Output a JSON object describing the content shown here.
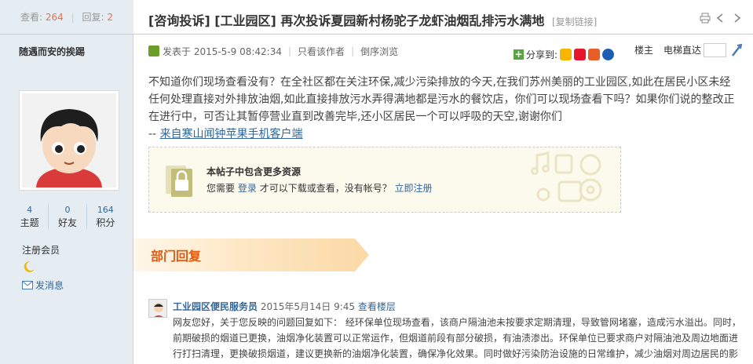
{
  "sidebar": {
    "views_label": "查看:",
    "views": "264",
    "replies_label": "回复:",
    "replies": "2",
    "username": "随遇而安的挨踢",
    "stats": [
      {
        "value": "4",
        "label": "主题"
      },
      {
        "value": "0",
        "label": "好友"
      },
      {
        "value": "164",
        "label": "积分"
      }
    ],
    "role": "注册会员",
    "message_label": "发消息"
  },
  "post": {
    "title": "[咨询投诉] [工业园区] 再次投诉夏园新村杨驼子龙虾油烟乱排污水满地",
    "copy_link": "[复制链接]",
    "posted_at": "发表于 2015-5-9 08:42:34",
    "only_author": "只看该作者",
    "reverse": "倒序浏览",
    "share_label": "分享到:",
    "floor_owner": "楼主",
    "floor_jump": "电梯直达",
    "content": "不知道你们现场查看没有？在全社区都在关注环保,减少污染排放的今天,在我们苏州美丽的工业园区,如此在居民小区未经任何处理直接对外排放油烟,如此直接排放污水弄得满地都是污水的餐饮店，你们可以现场查看下吗？如果你们说的整改正在进行中，可否让其暂停营业直到改善完毕,还小区居民一个可以呼吸的天空,谢谢你们",
    "source_prefix": "-- ",
    "source_link": "来自寒山闻钟苹果手机客户端",
    "locked_title": "本帖子中包含更多资源",
    "locked_need": "您需要",
    "locked_login": "登录",
    "locked_mid": "才可以下载或查看，没有帐号？",
    "locked_register": "立即注册"
  },
  "dept": {
    "banner": "部门回复",
    "name": "工业园区便民服务员",
    "date": "2015年5月14日 9:45",
    "view_floor": "查看楼层",
    "text": "网友您好，关于您反映的问题回复如下： 经环保单位现场查看，该商户隔油池未按要求定期清理，导致管网堵塞，造成污水溢出。同时，前期破损的烟道已更换，油烟净化装置可以正常运作，但烟道前段有部分破损，有油渍渗出。环保单位已要求商户对隔油池及周边地面进行打扫清理，更换破损烟道，建议更换新的油烟净化装置，确保净化效果。同时做好污染防治设施的日常维护，减少油烟对周边居民的影响。感谢网友对我们工作的关心和支持！ 若"
  },
  "colors": {
    "sidebar_bg": "#e5edf2",
    "accent_orange": "#e25a12",
    "link_blue": "#336699",
    "banner_bg": "#fde9c8"
  }
}
